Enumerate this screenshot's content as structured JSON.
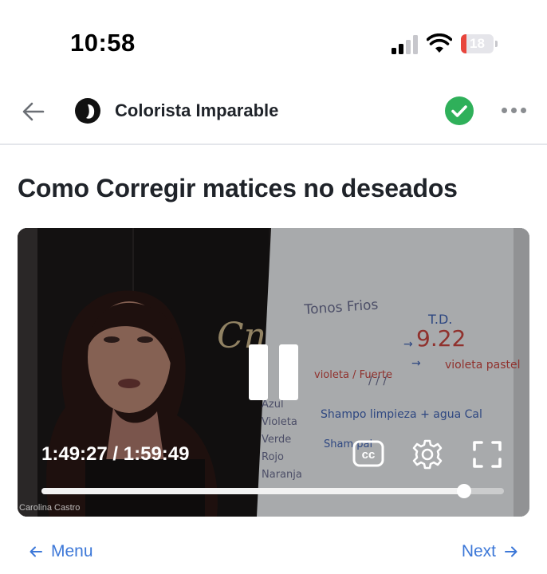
{
  "status_bar": {
    "time": "10:58",
    "battery_level": "18",
    "battery_fraction": 0.18,
    "signal_bars_filled": 2,
    "signal_bars_total": 4,
    "icons": [
      "cellular-signal-icon",
      "wifi-icon",
      "battery-icon"
    ]
  },
  "nav": {
    "back_icon": "arrow-left-icon",
    "channel_name": "Colorista Imparable",
    "verified_icon": "check-circle-icon",
    "more_icon": "ellipsis-icon"
  },
  "video": {
    "title": "Como Corregir matices no deseados",
    "elapsed": "1:49:27",
    "separator": " / ",
    "duration": "1:59:49",
    "progress_fraction": 0.913,
    "watermark": "Carolina Castro",
    "controls": [
      "pause-icon",
      "closed-captions-icon",
      "gear-icon",
      "fullscreen-icon"
    ],
    "whiteboard_text": {
      "heading": "Tonos Frios",
      "td_label": "T.D.",
      "td_value": "9.22",
      "violeta_pastel": "violeta pastel",
      "violeta_fuerte": "violeta / Fuerte",
      "left_list": [
        "Azul",
        "Violeta",
        "Verde",
        "Rojo",
        "Naranja"
      ],
      "shampoo_line": "Shampo limpieza + agua Cal",
      "second_line": "Sham pal"
    }
  },
  "footer": {
    "menu_label": "Menu",
    "next_label": "Next"
  },
  "colors": {
    "link": "#3d78d8",
    "verified": "#2fb05a",
    "battery_low": "#e8453c"
  }
}
